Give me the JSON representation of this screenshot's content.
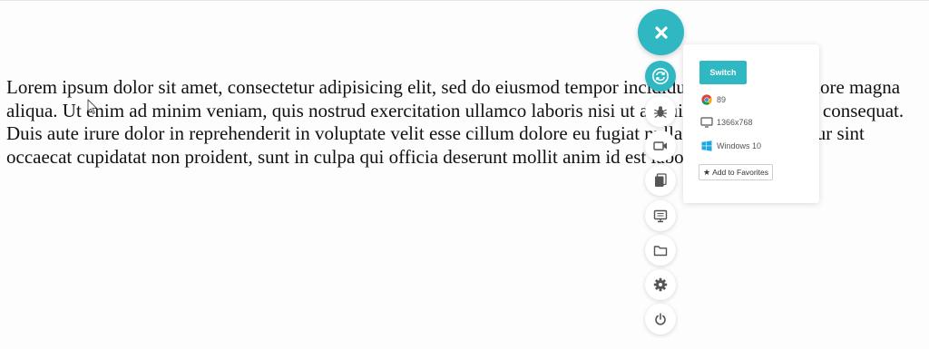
{
  "content": {
    "paragraph": "Lorem ipsum dolor sit amet, consectetur adipisicing elit, sed do eiusmod tempor incididunt ut labore et dolore magna aliqua. Ut enim ad minim veniam, quis nostrud exercitation ullamco laboris nisi ut aliquip ex ea commodo consequat. Duis aute irure dolor in reprehenderit in voluptate velit esse cillum dolore eu fugiat nulla pariatur. Excepteur sint occaecat cupidatat non proident, sunt in culpa qui officia deserunt mollit anim id est laborum."
  },
  "toolbar": {
    "accent_color": "#2fb7c2",
    "main_icon": "close-icon",
    "tools": [
      {
        "name": "switch-browser",
        "icon": "sync-icon",
        "active": true
      },
      {
        "name": "bug-report",
        "icon": "bug-icon",
        "active": false
      },
      {
        "name": "record-video",
        "icon": "video-camera-icon",
        "active": false
      },
      {
        "name": "screenshot",
        "icon": "gallery-icon",
        "active": false
      },
      {
        "name": "resolution",
        "icon": "monitor-icon",
        "active": false
      },
      {
        "name": "files",
        "icon": "folder-icon",
        "active": false
      },
      {
        "name": "settings",
        "icon": "gear-icon",
        "active": false
      },
      {
        "name": "power",
        "icon": "power-icon",
        "active": false
      }
    ]
  },
  "panel": {
    "switch_label": "Switch",
    "browser_version": "89",
    "resolution": "1366x768",
    "os": "Windows 10",
    "favorites_label": "Add to Favorites"
  }
}
